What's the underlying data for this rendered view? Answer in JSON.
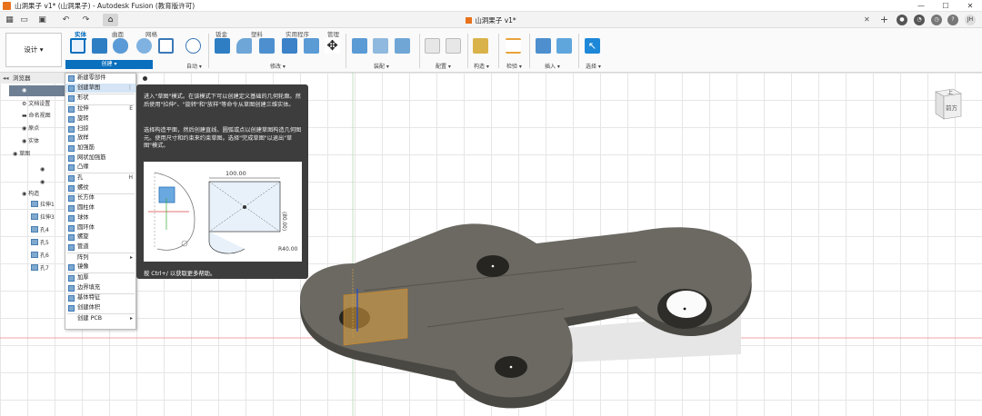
{
  "titlebar": {
    "title": "山洞果子 v1* (山洞果子) - Autodesk Fusion (教育版许可)",
    "minimize": "—",
    "maximize": "☐",
    "close": "✕"
  },
  "tabbar": {
    "doc_tab": "山洞果子 v1*",
    "doc_close": "✕",
    "add_tab": "+",
    "user_initials": "JH"
  },
  "ribbon": {
    "workspace": "设计 ▾",
    "tabs": [
      "实体",
      "曲面",
      "网格",
      "钣金",
      "塑料",
      "实用程序",
      "管理"
    ],
    "groups": [
      "创建 ▾",
      "自动 ▾",
      "修改 ▾",
      "装配 ▾",
      "配置 ▾",
      "构造 ▾",
      "检验 ▾",
      "插入 ▾",
      "选择 ▾"
    ]
  },
  "browser": {
    "title": "浏览器",
    "rows": [
      "文档设置",
      "命名视图",
      "原点",
      "实体",
      "草图",
      "",
      "",
      "构造",
      "拉伸1",
      "拉伸3",
      "孔4",
      "孔5",
      "孔6",
      "孔7"
    ]
  },
  "create_menu": {
    "items": [
      {
        "label": "新建零部件",
        "extra": ""
      },
      {
        "label": "创建草图",
        "extra": "⋮"
      },
      {
        "label": "形状",
        "extra": ""
      },
      {
        "label": "拉伸",
        "extra": "E"
      },
      {
        "label": "旋转",
        "extra": ""
      },
      {
        "label": "扫掠",
        "extra": ""
      },
      {
        "label": "放样",
        "extra": ""
      },
      {
        "label": "加强筋",
        "extra": ""
      },
      {
        "label": "网状加强筋",
        "extra": ""
      },
      {
        "label": "凸缘",
        "extra": ""
      },
      {
        "label": "孔",
        "extra": "H"
      },
      {
        "label": "螺纹",
        "extra": ""
      },
      {
        "label": "长方体",
        "extra": ""
      },
      {
        "label": "圆柱体",
        "extra": ""
      },
      {
        "label": "球体",
        "extra": ""
      },
      {
        "label": "圆环体",
        "extra": ""
      },
      {
        "label": "螺旋",
        "extra": ""
      },
      {
        "label": "管道",
        "extra": ""
      },
      {
        "label": "阵列",
        "extra": "▸"
      },
      {
        "label": "镜像",
        "extra": ""
      },
      {
        "label": "加厚",
        "extra": ""
      },
      {
        "label": "边界填充",
        "extra": ""
      },
      {
        "label": "基体特征",
        "extra": ""
      },
      {
        "label": "创建体积",
        "extra": ""
      },
      {
        "label": "创建 PCB",
        "extra": "▸"
      }
    ]
  },
  "tooltip": {
    "para1": "进入\"草图\"模式。在该模式下可以创建定义基础的几何轮廓。然后使用\"拉伸\"、\"旋转\"和\"放样\"等命令从草图创建三维实体。",
    "para2": "选择构造平面，然后创建直线、圆弧或点以创建草图构造几何图元。使用尺寸和约束来约束草图。选择\"完成草图\"以退出\"草图\"模式。",
    "dim_width": "100.00",
    "dim_height": "(80.00)",
    "dim_radius": "R40.00",
    "footer": "按 Ctrl+/ 以获取更多帮助。"
  },
  "viewcube": {
    "top": "上",
    "front": "前方"
  }
}
